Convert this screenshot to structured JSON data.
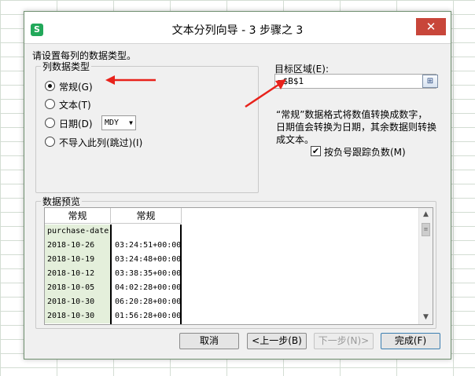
{
  "window": {
    "title": "文本分列向导 - 3 步骤之 3",
    "app_icon": "S",
    "close_glyph": "✕"
  },
  "instruction": "请设置每列的数据类型。",
  "column_type": {
    "group_label": "列数据类型",
    "options": [
      {
        "label": "常规(G)",
        "checked": true
      },
      {
        "label": "文本(T)",
        "checked": false
      },
      {
        "label": "日期(D)",
        "checked": false
      },
      {
        "label": "不导入此列(跳过)(I)",
        "checked": false
      }
    ],
    "date_format": "MDY"
  },
  "target": {
    "label": "目标区域(E):",
    "value": "=$B$1"
  },
  "description": [
    "“常规”数据格式将数值转换成数字，",
    "日期值会转换为日期，其余数据则转换",
    "成文本。"
  ],
  "track_negative": {
    "label": "按负号跟踪负数(M)",
    "checked": true
  },
  "preview": {
    "group_label": "数据预览",
    "headers": [
      "常规",
      "常规"
    ],
    "rows": [
      [
        "purchase-date",
        ""
      ],
      [
        "2018-10-26",
        "03:24:51+00:00"
      ],
      [
        "2018-10-19",
        "03:24:48+00:00"
      ],
      [
        "2018-10-12",
        "03:38:35+00:00"
      ],
      [
        "2018-10-05",
        "04:02:28+00:00"
      ],
      [
        "2018-10-30",
        "06:20:28+00:00"
      ],
      [
        "2018-10-30",
        "01:56:28+00:00"
      ]
    ]
  },
  "buttons": {
    "cancel": "取消",
    "back": "<上一步(B)",
    "next": "下一步(N)>",
    "finish": "完成(F)"
  },
  "colors": {
    "annotation_arrow": "#e8221b",
    "selected_column_bg": "#e4efdb"
  }
}
